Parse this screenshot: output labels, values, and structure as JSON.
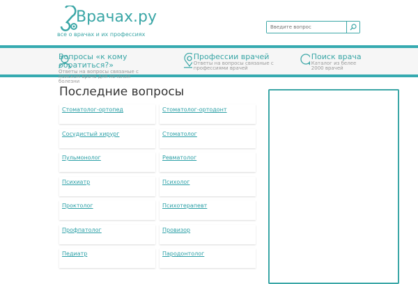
{
  "logo": {
    "name": "Врачах.ру",
    "tagline": "все о врачах и их профессиях"
  },
  "search": {
    "placeholder": "Введите вопрос"
  },
  "nav": [
    {
      "title": "Вопросы «к кому обратиться?»",
      "desc": "Ответы на вопросы связаные с поиском врача для лечения болезни"
    },
    {
      "title": "Профессии врачей",
      "desc": "Ответы на вопросы связаные с профессиями врачей"
    },
    {
      "title": "Поиск врача",
      "desc": "Каталог из белее 2000 врачей"
    }
  ],
  "main": {
    "title": "Последние вопросы",
    "items": [
      "Стоматолог-ортопед",
      "Стоматолог-ортодонт",
      "Сосудистый хирург",
      "Стоматолог",
      "Пульмонолог",
      "Ревматолог",
      "Психиатр",
      "Психолог",
      "Проктолог",
      "Психотерапевт",
      "Профпатолог",
      "Провизор",
      "Педиатр",
      "Пародонтолог"
    ]
  },
  "colors": {
    "accent": "#36aab0"
  }
}
